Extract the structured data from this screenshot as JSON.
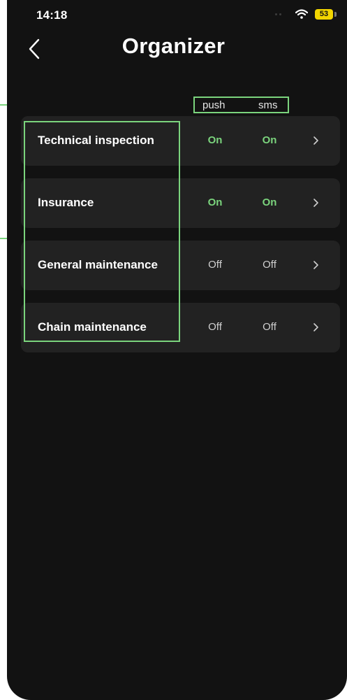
{
  "status_bar": {
    "time": "14:18",
    "battery": "53"
  },
  "header": {
    "title": "Organizer"
  },
  "columns": {
    "push": "push",
    "sms": "sms"
  },
  "rows": [
    {
      "label": "Technical inspection",
      "push": "On",
      "sms": "On"
    },
    {
      "label": "Insurance",
      "push": "On",
      "sms": "On"
    },
    {
      "label": "General maintenance",
      "push": "Off",
      "sms": "Off"
    },
    {
      "label": "Chain maintenance",
      "push": "Off",
      "sms": "Off"
    }
  ],
  "colors": {
    "background": "#121212",
    "row_background": "#222222",
    "accent_green": "#7bd47d",
    "battery_yellow": "#f2d500"
  },
  "icons": {
    "back": "chevron-left-icon",
    "row_action": "chevron-right-icon",
    "wifi": "wifi-icon",
    "battery": "battery-icon"
  }
}
